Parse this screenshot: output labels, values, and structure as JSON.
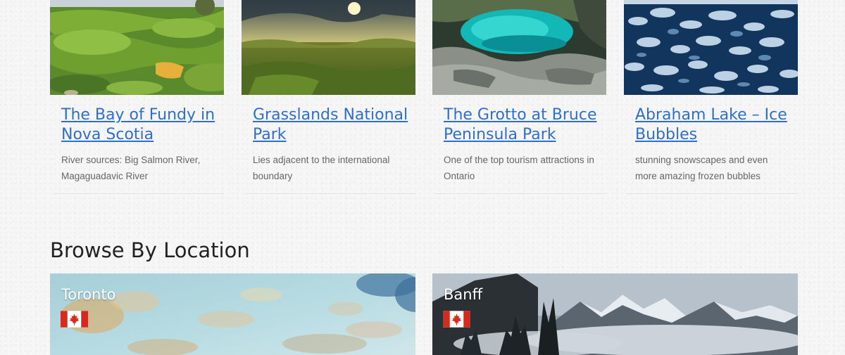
{
  "attractions": [
    {
      "title": "The Bay of Fundy in Nova Scotia",
      "description": "River sources: Big Salmon River, Magaguadavic River",
      "image": "green-coast-photo"
    },
    {
      "title": "Grasslands National Park",
      "description": "Lies adjacent to the international boundary",
      "image": "prairie-sunset-photo"
    },
    {
      "title": "The Grotto at Bruce Peninsula Park",
      "description": "One of the top tourism attractions in Ontario",
      "image": "turquoise-grotto-photo"
    },
    {
      "title": "Abraham Lake – Ice Bubbles",
      "description": "stunning snowscapes and even more amazing frozen bubbles",
      "image": "ice-bubbles-photo"
    }
  ],
  "browse": {
    "title": "Browse By Location",
    "locations": [
      {
        "name": "Toronto",
        "flag": "canada-flag-icon"
      },
      {
        "name": "Banff",
        "flag": "canada-flag-icon"
      }
    ]
  },
  "colors": {
    "link": "#2f6fc9",
    "text": "#222222",
    "muted": "#666666",
    "flag_red": "#d52b1e"
  }
}
